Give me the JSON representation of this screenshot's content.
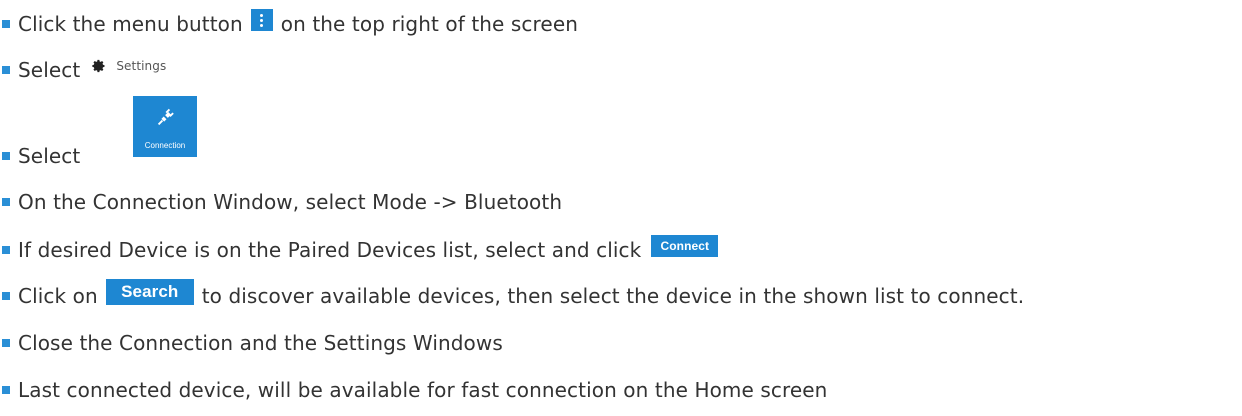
{
  "accent_color": "#1e87d2",
  "bullet_color": "#2a8fd6",
  "steps": [
    {
      "before": "Click the menu button",
      "after": "on the top right of the screen",
      "icon": "vertical-dots-menu-icon"
    },
    {
      "before": "Select",
      "icon": "gear-icon",
      "chip_label": "Settings"
    },
    {
      "before": "Select",
      "icon": "plug-icon",
      "tile_label": "Connection"
    },
    {
      "text": "On the Connection Window, select Mode -> Bluetooth"
    },
    {
      "before": "If desired Device is on the Paired Devices list, select and click",
      "button_label": "Connect"
    },
    {
      "before": "Click on",
      "button_label": "Search",
      "after": "to discover available devices, then select the device in the shown list to connect."
    },
    {
      "text": "Close the Connection and the Settings Windows"
    },
    {
      "text": "Last connected device, will be available for fast connection on the Home screen"
    }
  ]
}
